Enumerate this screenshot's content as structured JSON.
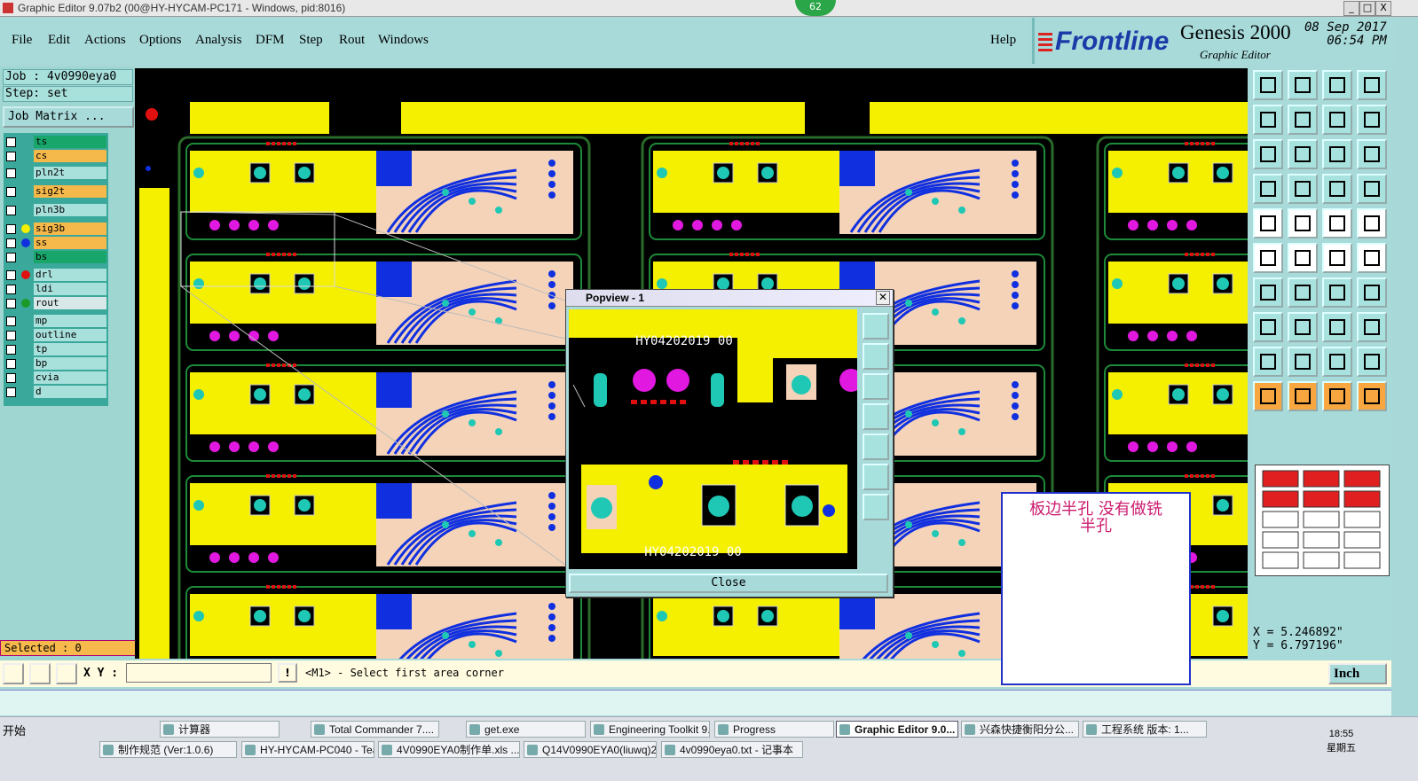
{
  "window": {
    "title": "Graphic Editor 9.07b2 (00@HY-HYCAM-PC171 - Windows, pid:8016)",
    "badge": "62",
    "min": "_",
    "max": "□",
    "close": "X"
  },
  "menu": {
    "items": [
      "File",
      "Edit",
      "Actions",
      "Options",
      "Analysis",
      "DFM",
      "Step",
      "Rout",
      "Windows"
    ],
    "help": "Help"
  },
  "brand": {
    "logo": "Frontline",
    "product": "Genesis 2000",
    "subtitle": "Graphic Editor",
    "date": "08 Sep 2017",
    "time": "06:54 PM"
  },
  "job": {
    "job_label": "Job : 4v0990eya0",
    "step_label": "Step: set",
    "matrix_button": "Job Matrix ..."
  },
  "layers": [
    {
      "name": "ts",
      "color": "#18a66a",
      "dot": ""
    },
    {
      "name": "cs",
      "color": "#f5b84a",
      "dot": ""
    },
    {
      "name": "pln2t",
      "color": "#a8e0dc",
      "dot": ""
    },
    {
      "name": "sig2t",
      "color": "#f5b84a",
      "dot": ""
    },
    {
      "name": "pln3b",
      "color": "#a8e0dc",
      "dot": ""
    },
    {
      "name": "sig3b",
      "color": "#f5b84a",
      "dot": "#f5f000"
    },
    {
      "name": "ss",
      "color": "#f5b84a",
      "dot": "#1030e0"
    },
    {
      "name": "bs",
      "color": "#18a66a",
      "dot": ""
    },
    {
      "name": "drl",
      "color": "#a8e0dc",
      "dot": "#e01010"
    },
    {
      "name": "ldi",
      "color": "#a8e0dc",
      "dot": ""
    },
    {
      "name": "rout",
      "color": "#d8e8e8",
      "dot": "#1b9a2a"
    },
    {
      "name": "mp",
      "color": "#a8e0dc",
      "dot": ""
    },
    {
      "name": "outline",
      "color": "#a8e0dc",
      "dot": ""
    },
    {
      "name": "tp",
      "color": "#a8e0dc",
      "dot": ""
    },
    {
      "name": "bp",
      "color": "#a8e0dc",
      "dot": ""
    },
    {
      "name": "cvia",
      "color": "#a8e0dc",
      "dot": ""
    },
    {
      "name": "d",
      "color": "#a8e0dc",
      "dot": ""
    }
  ],
  "selected": "Selected : 0",
  "coords": {
    "x": "X = 5.246892\"",
    "y": "Y = 6.797196\""
  },
  "input": {
    "xy_label": "X Y :",
    "excl": "!",
    "prompt": "<M1> - Select first area corner",
    "unit": "Inch"
  },
  "popview": {
    "title": "Popview - 1",
    "close_x": "✕",
    "close_button": "Close",
    "silk_text": "HY04202019 00"
  },
  "note": {
    "line1": "板边半孔   没有做铣",
    "line2": "半孔"
  },
  "taskbar": {
    "start": "开始",
    "row1": [
      "计算器",
      "Total Commander 7....",
      "get.exe",
      "Engineering Toolkit 9....",
      "Progress",
      "Graphic Editor 9.0...",
      "兴森快捷衡阳分公...",
      "工程系统   版本: 1..."
    ],
    "row2": [
      "制作规范 (Ver:1.0.6)",
      "HY-HYCAM-PC040 - Tea...",
      "4V0990EYA0制作单.xls ...",
      "Q14V0990EYA0(liuwq)20...",
      "4v0990eya0.txt - 记事本"
    ],
    "clock_time": "18:55",
    "clock_day": "星期五"
  }
}
